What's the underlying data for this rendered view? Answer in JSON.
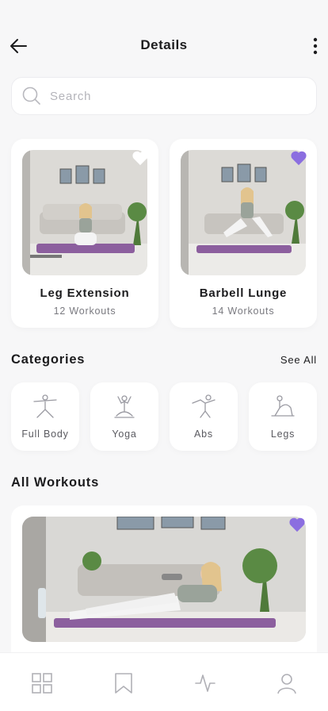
{
  "header": {
    "title": "Details"
  },
  "search": {
    "placeholder": "Search",
    "value": ""
  },
  "featured": [
    {
      "name": "Leg Extension",
      "subtitle": "12 Workouts",
      "favorite_color": "#ffffff"
    },
    {
      "name": "Barbell Lunge",
      "subtitle": "14 Workouts",
      "favorite_color": "#8b6ee0"
    }
  ],
  "categories": {
    "title": "Categories",
    "see_all": "See All",
    "items": [
      {
        "label": "Full Body",
        "icon": "full-body-icon"
      },
      {
        "label": "Yoga",
        "icon": "yoga-icon"
      },
      {
        "label": "Abs",
        "icon": "abs-icon"
      },
      {
        "label": "Legs",
        "icon": "legs-icon"
      }
    ]
  },
  "all_workouts": {
    "title": "All Workouts"
  },
  "tabbar": [
    "grid-icon",
    "bookmark-icon",
    "activity-icon",
    "profile-icon"
  ],
  "colors": {
    "accent": "#8b6ee0",
    "background": "#f7f7f8",
    "mat": "#8c5f9e"
  }
}
